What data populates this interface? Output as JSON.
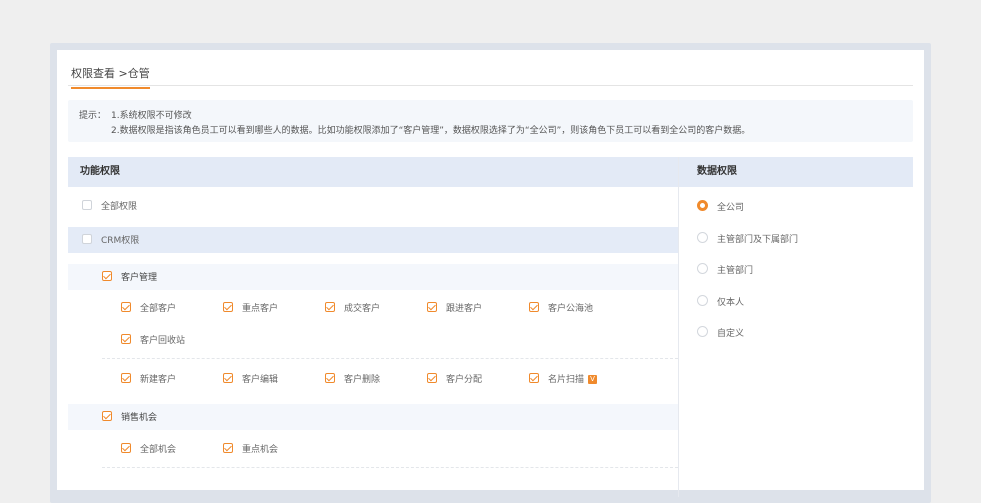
{
  "tab": {
    "label": "权限查看 >仓管"
  },
  "tip": {
    "prefix": "提示：",
    "line1": "1.系统权限不可修改",
    "line2": "2.数据权限是指该角色员工可以看到哪些人的数据。比如功能权限添加了“客户管理”，数据权限选择了为“全公司”，则该角色下员工可以看到全公司的客户数据。"
  },
  "function_panel": {
    "title": "功能权限",
    "all_label": "全部权限",
    "crm_label": "CRM权限",
    "groups": [
      {
        "label": "客户管理",
        "rows": [
          [
            "全部客户",
            "重点客户",
            "成交客户",
            "跟进客户",
            "客户公海池"
          ],
          [
            "客户回收站"
          ],
          [
            "新建客户",
            "客户编辑",
            "客户删除",
            "客户分配",
            "名片扫描"
          ]
        ]
      },
      {
        "label": "销售机会",
        "rows": [
          [
            "全部机会",
            "重点机会"
          ]
        ]
      }
    ],
    "badge": "V"
  },
  "data_panel": {
    "title": "数据权限",
    "options": [
      "全公司",
      "主管部门及下属部门",
      "主管部门",
      "仅本人",
      "自定义"
    ],
    "selected": "全公司"
  },
  "colors": {
    "accent": "#f08a2c",
    "header_bg": "#e3eaf6"
  }
}
